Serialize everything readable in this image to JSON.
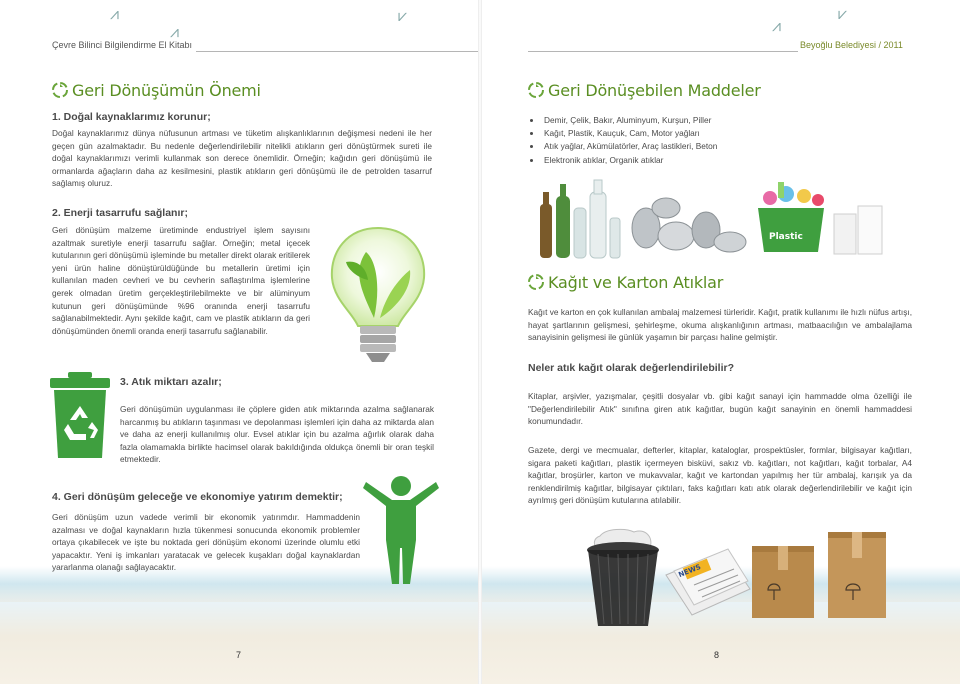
{
  "header": {
    "left_title": "Çevre Bilinci Bilgilendirme El Kitabı",
    "right_title": "Beyoğlu Belediyesi / 2011"
  },
  "left_page": {
    "section_title": "Geri Dönüşümün Önemi",
    "item1": {
      "title": "1. Doğal kaynaklarımız korunur;",
      "text": "Doğal kaynaklarımız dünya nüfusunun artması ve tüketim alışkanlıklarının değişmesi nedeni ile her geçen gün azalmaktadır. Bu nedenle değerlendirilebilir nitelikli atıkların geri dönüştürmek sureti ile doğal kaynaklarımızı verimli kullanmak son derece önemlidir. Örneğin; kağıdın geri dönüşümü ile ormanlarda ağaçların daha az kesilmesini, plastik atıkların geri dönüşümü ile de petrolden tasarruf sağlamış oluruz."
    },
    "item2": {
      "title": "2. Enerji tasarrufu sağlanır;",
      "text": "Geri dönüşüm malzeme üretiminde endustriyel işlem sayısını azaltmak suretiyle enerji tasarrufu sağlar. Örneğin; metal içecek kutularının geri dönüşümü işleminde bu metaller direkt olarak eritilerek yeni ürün haline dönüştürüldüğünde bu metallerin üretimi için kullanılan maden cevheri ve bu cevherin saflaştırılma işlemlerine gerek olmadan üretim gerçekleştirilebilmekte ve bir alüminyum kutunun geri dönüşümünde %96 oranında enerji tasarrufu sağlanabilmektedir. Aynı şekilde kağıt, cam ve plastik atıkların da geri dönüşümünden önemli oranda enerji tasarrufu sağlanabilir."
    },
    "item3": {
      "title": "3. Atık miktarı azalır;",
      "text": "Geri dönüşümün uygulanması ile çöplere giden atık miktarında azalma sağlanarak harcanmış bu atıkların taşınması ve depolanması işlemleri için daha az miktarda alan ve daha az enerji kullanılmış olur. Evsel atıklar için bu azalma ağırlık olarak daha fazla olamamakla birlikte hacimsel olarak bakıldığında oldukça önemli bir oran teşkil etmektedir."
    },
    "item4": {
      "title": "4. Geri dönüşüm geleceğe ve ekonomiye yatırım demektir;",
      "text": "Geri dönüşüm uzun vadede verimli bir ekonomik yatırımdır. Hammaddenin azalması ve doğal kaynakların hızla tükenmesi sonucunda ekonomik problemler ortaya çıkabilecek ve işte bu noktada geri dönüşüm ekonomi üzerinde olumlu etki yapacaktır. Yeni iş imkanları yaratacak ve gelecek kuşakları doğal kaynaklardan yararlanma olanağı sağlayacaktır."
    },
    "page_number": "7"
  },
  "right_page": {
    "section1_title": "Geri Dönüşebilen Maddeler",
    "materials": [
      "Demir, Çelik, Bakır, Aluminyum, Kurşun, Piller",
      "Kağıt, Plastik, Kauçuk, Cam, Motor yağları",
      "Atık yağlar, Akümülatörler, Araç lastikleri, Beton",
      "Elektronik atıklar, Organik atıklar"
    ],
    "bin_label": "Plastic",
    "section2_title": "Kağıt ve Karton Atıklar",
    "para1": "Kağıt ve karton en çok kullanılan ambalaj malzemesi türleridir. Kağıt, pratik kullanımı ile hızlı nüfus artışı, hayat şartlarının gelişmesi, şehirleşme, okuma alışkanlığının artması, matbaacılığın ve ambalajlama sanayisinin gelişmesi ile günlük yaşamın bir parçası haline gelmiştir.",
    "question": "Neler atık kağıt olarak değerlendirilebilir?",
    "para2": "Kitaplar, arşivler, yazışmalar, çeşitli dosyalar vb. gibi kağıt sanayi için hammadde olma özelliği ile \"Değerlendirilebilir Atık\" sınıfına giren atık kağıtlar, bugün kağıt sanayinin en önemli hammaddesi konumundadır.",
    "para3": "Gazete, dergi ve mecmualar, defterler, kitaplar, kataloglar, prospektüsler, formlar, bilgisayar kağıtları, sigara paketi kağıtları, plastik içermeyen bisküvi, sakız vb. kağıtları, not kağıtları, kağıt torbalar, A4 kağıtlar, broşürler, karton ve mukavvalar, kağıt ve kartondan yapılmış her tür ambalaj, karışık ya da renklendirilmiş kağıtlar, bilgisayar çıktıları, faks kağıtları katı atık olarak değerlendirilebilir ve kağıt için ayrılmış geri dönüşüm kutularına atılabilir.",
    "newspaper_label": "NEWS",
    "page_number": "8"
  },
  "colors": {
    "heading_green": "#5a8e22",
    "bin_green": "#3f9f3f",
    "box_brown": "#b98a4c"
  }
}
